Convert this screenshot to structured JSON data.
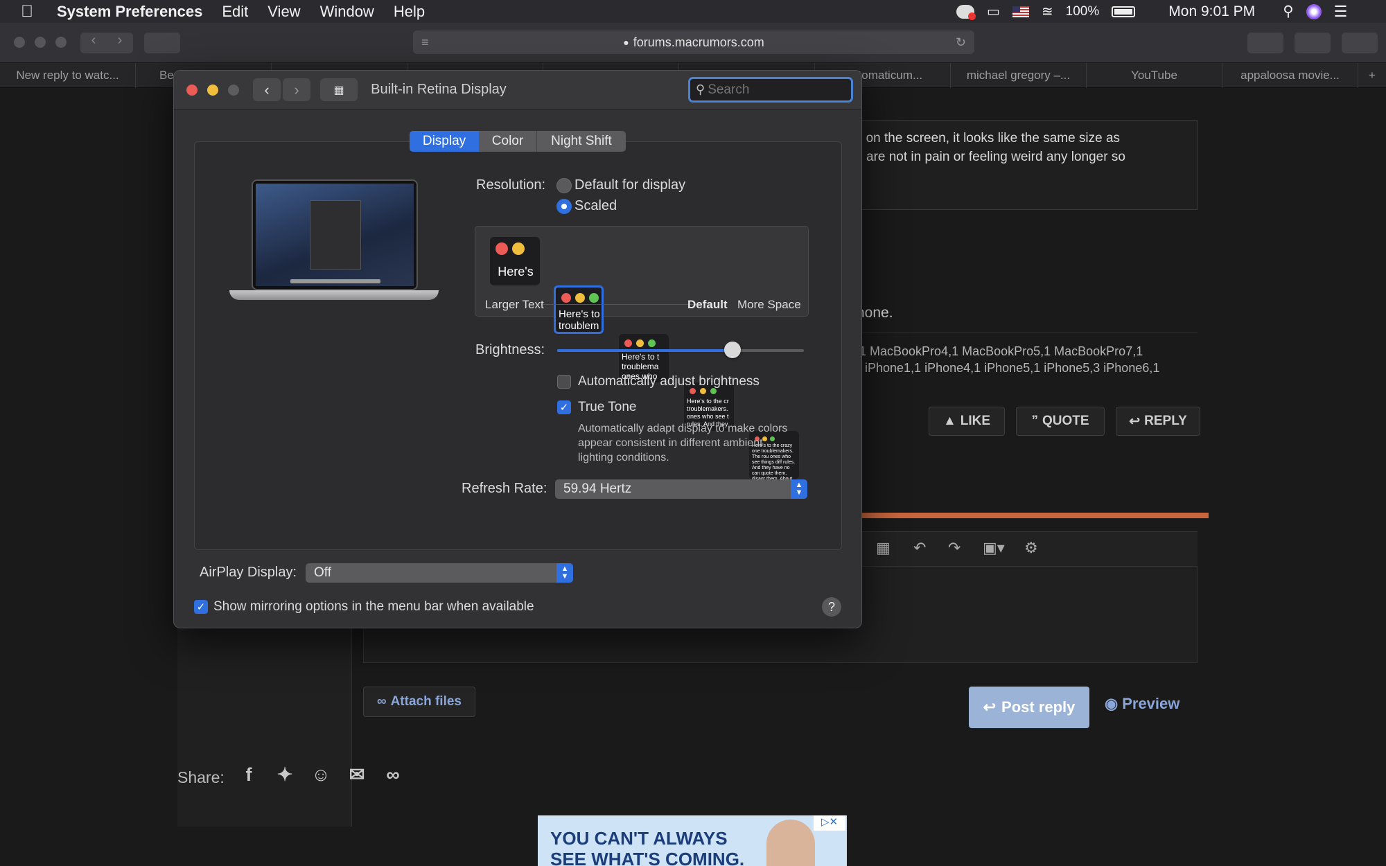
{
  "menubar": {
    "app_name": "System Preferences",
    "menus": [
      "Edit",
      "View",
      "Window",
      "Help"
    ],
    "battery": "100%",
    "clock": "Mon 9:01 PM"
  },
  "safari": {
    "url": "forums.macrumors.com",
    "tabs": [
      "New reply to watc...",
      "Be",
      "",
      "",
      "",
      "",
      "a stomaticum...",
      "michael gregory –...",
      "YouTube",
      "appaloosa movie..."
    ]
  },
  "forum": {
    "post_line1": "r on the screen, it looks like the same size as",
    "post_line2": "are not in pain or feeling weird any longer so",
    "one_line": "hone.",
    "sig_line1": "1 MacBookPro4,1 MacBookPro5,1 MacBookPro7,1",
    "sig_line2": ". iPhone1,1 iPhone4,1 iPhone5,1 iPhone5,3 iPhone6,1",
    "like": "LIKE",
    "quote": "QUOTE",
    "reply": "REPLY",
    "attach": "Attach files",
    "post_reply": "Post reply",
    "preview": "Preview",
    "share": "Share:",
    "ad_line1": "YOU CAN'T ALWAYS",
    "ad_line2": "SEE WHAT'S COMING."
  },
  "prefs": {
    "title": "Built-in Retina Display",
    "search_placeholder": "Search",
    "tabs": [
      "Display",
      "Color",
      "Night Shift"
    ],
    "resolution_label": "Resolution:",
    "res_default": "Default for display",
    "res_scaled": "Scaled",
    "thumbs": [
      "Here's",
      "Here's to troublem",
      "Here's to t troublema ones who",
      "Here's to the cr troublemakers. ones who see t rules. And they",
      "Here's to the crazy one troublemakers. The rou ones who see things diff rules. And they have no can quote them, disagr them. About the only th Because they change th"
    ],
    "scale_larger": "Larger Text",
    "scale_default": "Default",
    "scale_more": "More Space",
    "brightness_label": "Brightness:",
    "brightness_value": 0.71,
    "auto_brightness": "Automatically adjust brightness",
    "true_tone": "True Tone",
    "true_tone_desc1": "Automatically adapt display to make colors",
    "true_tone_desc2": "appear consistent in different ambient",
    "true_tone_desc3": "lighting conditions.",
    "refresh_label": "Refresh Rate:",
    "refresh_value": "59.94 Hertz",
    "airplay_label": "AirPlay Display:",
    "airplay_value": "Off",
    "mirroring": "Show mirroring options in the menu bar when available",
    "help": "?"
  }
}
